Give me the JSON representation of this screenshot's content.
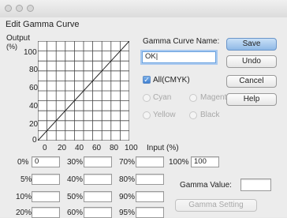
{
  "dialog": {
    "title": "Edit Gamma Curve"
  },
  "graph": {
    "y_label": "Output",
    "y_unit": "(%)",
    "y_ticks": [
      "100",
      "80",
      "60",
      "40",
      "20",
      "0"
    ],
    "x_ticks": [
      "0",
      "20",
      "40",
      "60",
      "80",
      "100"
    ],
    "x_label": "Input (%)"
  },
  "curve_name": {
    "label": "Gamma Curve Name:",
    "value": "OK|"
  },
  "channels": {
    "all": {
      "label": "All(CMYK)",
      "checked": true
    },
    "cyan": "Cyan",
    "magenta": "Magenta",
    "yellow": "Yellow",
    "black": "Black"
  },
  "buttons": {
    "save": "Save",
    "undo": "Undo",
    "cancel": "Cancel",
    "help": "Help",
    "gamma_setting": "Gamma Setting"
  },
  "points": [
    {
      "label": "0%",
      "value": "0"
    },
    {
      "label": "5%",
      "value": ""
    },
    {
      "label": "10%",
      "value": ""
    },
    {
      "label": "20%",
      "value": ""
    },
    {
      "label": "30%",
      "value": ""
    },
    {
      "label": "40%",
      "value": ""
    },
    {
      "label": "50%",
      "value": ""
    },
    {
      "label": "60%",
      "value": ""
    },
    {
      "label": "70%",
      "value": ""
    },
    {
      "label": "80%",
      "value": ""
    },
    {
      "label": "90%",
      "value": ""
    },
    {
      "label": "95%",
      "value": ""
    },
    {
      "label": "100%",
      "value": "100"
    }
  ],
  "gamma_value": {
    "label": "Gamma Value:",
    "value": ""
  }
}
